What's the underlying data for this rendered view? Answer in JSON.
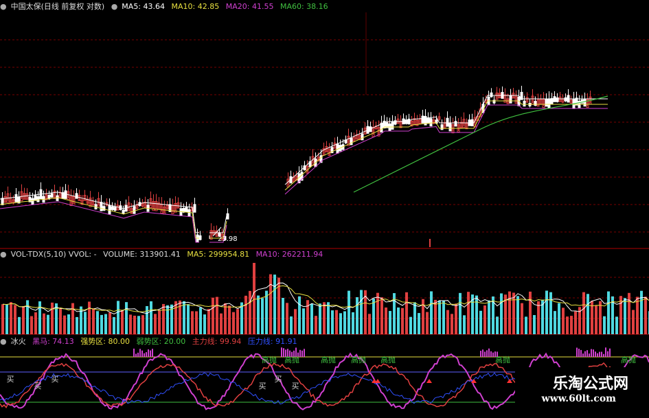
{
  "colors": {
    "up": "#e04040",
    "down": "#4fd8e0",
    "ma5": "#ffffff",
    "ma10": "#e8e040",
    "ma20": "#d040d0",
    "ma60": "#40c040",
    "grid": "#7a0000"
  },
  "price_legend": {
    "title": "中国太保(日线 前复权 对数)",
    "ma5": "MA5: 43.64",
    "ma10": "MA10: 42.85",
    "ma20": "MA20: 41.55",
    "ma60": "MA60: 38.16"
  },
  "price_low_label": "23.98",
  "vol_legend": {
    "title": "VOL-TDX(5,10) VVOL: -",
    "volume": "VOLUME: 313901.41",
    "ma5": "MA5: 299954.81",
    "ma10": "MA10: 262211.94"
  },
  "ind_legend": {
    "title": "冰火",
    "black_horse": "黑马: 74.13",
    "strong": "强势区: 80.00",
    "weak": "弱势区: 20.00",
    "main": "主力线: 99.94",
    "pressure": "压力线: 91.91"
  },
  "ind_signals": {
    "sell_high": "高抛",
    "buy_low": "买"
  },
  "watermark": {
    "title": "乐淘公式网",
    "url": "www.60lt.com"
  }
}
